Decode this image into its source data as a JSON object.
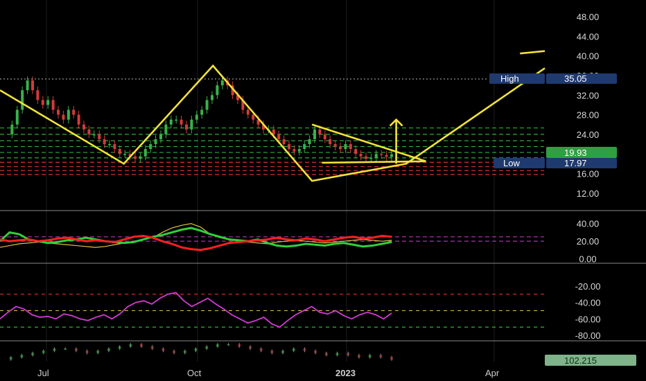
{
  "chart_data": {
    "type": "candlestick-with-indicators",
    "x_labels": [
      "Jul",
      "Oct",
      "2023",
      "Apr"
    ],
    "main_panel": {
      "y_ticks": [
        "48.00",
        "44.00",
        "40.00",
        "36.00",
        "32.00",
        "28.00",
        "24.00",
        "20.00",
        "16.00",
        "12.00"
      ],
      "ylim": [
        9,
        50
      ],
      "high_label": "High",
      "high_value": "35.05",
      "low_label": "Low",
      "low_value": "17.97",
      "last_price": "19.93",
      "green_dashed_levels": [
        19.2,
        20.3,
        21.5,
        22.7,
        24.0,
        25.3
      ],
      "red_dashed_levels": [
        15.8,
        16.6,
        17.4,
        18.3
      ],
      "close_series": [
        24,
        26,
        29,
        33,
        35,
        33,
        31,
        30,
        31,
        29,
        28,
        27,
        29,
        28,
        26,
        25,
        24,
        24,
        23,
        22,
        22,
        21,
        20,
        20,
        19.5,
        19,
        19.5,
        21,
        22,
        23,
        24,
        26,
        27,
        27,
        26,
        25,
        27,
        28,
        29,
        31,
        32,
        34,
        35,
        34,
        32,
        31,
        29,
        28,
        27,
        26,
        25,
        25,
        24,
        23,
        22,
        21,
        20.5,
        21,
        22,
        23,
        25,
        24,
        23,
        22,
        21.5,
        21,
        22,
        21,
        20,
        19.5,
        19,
        19.2,
        20,
        19.8,
        19.4,
        19.93
      ],
      "pattern_lines": [
        {
          "points": [
            [
              0,
              33
            ],
            [
              25,
              18
            ],
            [
              43,
              38
            ],
            [
              63,
              14.5
            ],
            [
              82,
              18
            ],
            [
              110,
              37.5
            ]
          ]
        },
        {
          "points": [
            [
              63,
              26
            ],
            [
              86,
              18.5
            ]
          ]
        },
        {
          "points": [
            [
              65,
              18.2
            ],
            [
              86,
              18.5
            ]
          ]
        },
        {
          "points": [
            [
              105,
              40.5
            ],
            [
              110,
              41
            ]
          ]
        }
      ],
      "arrow": {
        "x": 80,
        "from": 18,
        "to": 27
      }
    },
    "dmi_panel": {
      "y_ticks": [
        "40.00",
        "20.00",
        "0.00"
      ],
      "ylim": [
        -5,
        50
      ],
      "green_series": [
        20,
        30,
        28,
        22,
        20,
        18,
        19,
        21,
        22,
        24,
        22,
        20,
        19,
        18,
        19,
        22,
        25,
        27,
        30,
        33,
        35,
        32,
        28,
        25,
        22,
        21,
        20,
        22,
        18,
        15,
        14,
        15,
        17,
        16,
        15,
        17,
        18,
        16,
        14,
        15,
        17,
        19
      ],
      "red_series": [
        22,
        20,
        21,
        22,
        20,
        21,
        23,
        24,
        22,
        20,
        21,
        20,
        19,
        22,
        25,
        26,
        24,
        20,
        17,
        13,
        11,
        10,
        12,
        15,
        18,
        19,
        20,
        21,
        22,
        24,
        22,
        21,
        23,
        22,
        20,
        22,
        24,
        25,
        23,
        24,
        26,
        25
      ],
      "yellow_series": [
        13,
        15,
        17,
        18,
        19,
        18,
        17,
        16,
        15,
        14,
        13,
        14,
        16,
        18,
        20,
        22,
        24,
        30,
        35,
        38,
        40,
        36,
        28,
        24,
        22,
        20,
        19,
        18,
        17,
        19,
        20,
        21,
        20,
        19,
        18,
        19,
        20,
        21,
        22,
        21,
        20,
        21
      ],
      "dashed_levels": [
        {
          "value": 20,
          "color": "#d23cd2"
        },
        {
          "value": 25,
          "color": "#d23cd2"
        }
      ]
    },
    "oscillator_panel": {
      "y_ticks": [
        "-20.00",
        "-40.00",
        "-60.00",
        "-80.00"
      ],
      "ylim": [
        -85,
        -5
      ],
      "series": [
        -60,
        -52,
        -45,
        -48,
        -55,
        -58,
        -57,
        -60,
        -54,
        -56,
        -60,
        -62,
        -58,
        -55,
        -60,
        -54,
        -45,
        -40,
        -38,
        -42,
        -35,
        -30,
        -28,
        -38,
        -45,
        -40,
        -35,
        -42,
        -48,
        -55,
        -60,
        -65,
        -62,
        -58,
        -66,
        -70,
        -62,
        -55,
        -50,
        -45,
        -52,
        -54,
        -50,
        -56,
        -60,
        -55,
        -52,
        -55,
        -60,
        -53
      ],
      "levels": [
        {
          "value": -30,
          "color": "#e03030"
        },
        {
          "value": -50,
          "color": "#d8b44a"
        },
        {
          "value": -70,
          "color": "#3cc43c"
        }
      ]
    },
    "volume_panel": {
      "value_badge": "102.215",
      "series": [
        1,
        2,
        3,
        4,
        5,
        6,
        6,
        5,
        4,
        5,
        6,
        7,
        8,
        7,
        6,
        5,
        4,
        5,
        6,
        7,
        8,
        8,
        7,
        6,
        5,
        4,
        5,
        6,
        5,
        4,
        3,
        4,
        3,
        2,
        3,
        2,
        1
      ]
    }
  }
}
